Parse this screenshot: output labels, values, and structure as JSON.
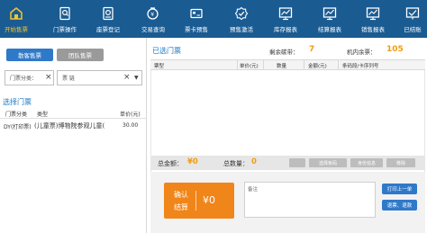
{
  "toolbar": {
    "items": [
      {
        "label": "开始售票",
        "icon": "home-icon",
        "active": true
      },
      {
        "label": "门票操作",
        "icon": "ticket-ops-icon"
      },
      {
        "label": "座票登记",
        "icon": "seat-register-icon"
      },
      {
        "label": "交易查询",
        "icon": "transaction-search-icon"
      },
      {
        "label": "票卡预售",
        "icon": "card-presale-icon"
      },
      {
        "label": "预售激活",
        "icon": "presale-activate-icon"
      },
      {
        "label": "库存报表",
        "icon": "stock-report-icon"
      },
      {
        "label": "结算报表",
        "icon": "settlement-report-icon"
      },
      {
        "label": "销售报表",
        "icon": "sales-report-icon"
      },
      {
        "label": "已结账",
        "icon": "checked-out-icon"
      }
    ]
  },
  "left": {
    "tab_individual": "散客售票",
    "tab_group": "团队售票",
    "filter_category": "门票分类：",
    "filter_ticket": "票 链",
    "select_title": "选择门票",
    "columns": [
      "门票分类",
      "类型",
      "单价(元)"
    ],
    "rows": [
      {
        "category": "DY(打印票)",
        "name": "(儿童票)博物院参观儿童(",
        "price": "30.00"
      }
    ]
  },
  "right": {
    "title": "已选门票",
    "remaining_ribbon_label": "剩余碳带：",
    "remaining_ribbon_value": "7",
    "machine_balance_label": "机内余票：",
    "machine_balance_value": "105",
    "columns": [
      "票型",
      "单价(元)",
      "数量",
      "金额(元)",
      "条码段/卡序列号"
    ],
    "total_amount_label": "总金额：",
    "total_amount_value": "¥0",
    "total_qty_label": "总数量：",
    "total_qty_value": "0",
    "btn_select_barcode": "选择条码",
    "btn_id_info": "身份信息",
    "btn_delete": "移除",
    "confirm_line1": "确认",
    "confirm_line2": "结算",
    "confirm_amount": "¥0",
    "note_label": "备注",
    "btn_print_last": "打印上一单",
    "btn_refund": "退票、退款"
  },
  "colors": {
    "toolbar": "#1a5b92",
    "accent": "#f39c12",
    "primary": "#2f79c9",
    "confirm": "#f0851a"
  }
}
